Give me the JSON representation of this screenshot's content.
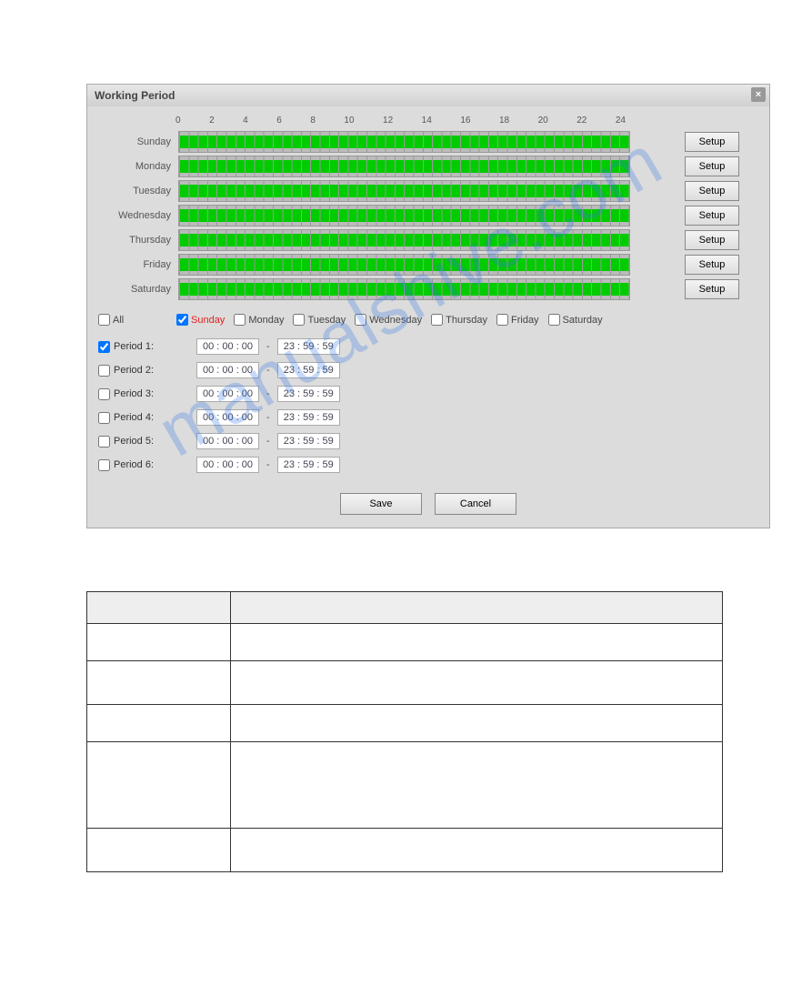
{
  "dialog": {
    "title": "Working Period",
    "hours": [
      "0",
      "2",
      "4",
      "6",
      "8",
      "10",
      "12",
      "14",
      "16",
      "18",
      "20",
      "22",
      "24"
    ],
    "days": [
      "Sunday",
      "Monday",
      "Tuesday",
      "Wednesday",
      "Thursday",
      "Friday",
      "Saturday"
    ],
    "setup_label": "Setup",
    "all_label": "All",
    "daycheck_labels": [
      "Sunday",
      "Monday",
      "Tuesday",
      "Wednesday",
      "Thursday",
      "Friday",
      "Saturday"
    ],
    "daycheck_selected": 0,
    "periods": [
      {
        "label": "Period 1:",
        "checked": true,
        "from": [
          "00",
          "00",
          "00"
        ],
        "to": [
          "23",
          "59",
          "59"
        ]
      },
      {
        "label": "Period 2:",
        "checked": false,
        "from": [
          "00",
          "00",
          "00"
        ],
        "to": [
          "23",
          "59",
          "59"
        ]
      },
      {
        "label": "Period 3:",
        "checked": false,
        "from": [
          "00",
          "00",
          "00"
        ],
        "to": [
          "23",
          "59",
          "59"
        ]
      },
      {
        "label": "Period 4:",
        "checked": false,
        "from": [
          "00",
          "00",
          "00"
        ],
        "to": [
          "23",
          "59",
          "59"
        ]
      },
      {
        "label": "Period 5:",
        "checked": false,
        "from": [
          "00",
          "00",
          "00"
        ],
        "to": [
          "23",
          "59",
          "59"
        ]
      },
      {
        "label": "Period 6:",
        "checked": false,
        "from": [
          "00",
          "00",
          "00"
        ],
        "to": [
          "23",
          "59",
          "59"
        ]
      }
    ],
    "save_label": "Save",
    "cancel_label": "Cancel"
  },
  "watermark": "manualshive.com"
}
